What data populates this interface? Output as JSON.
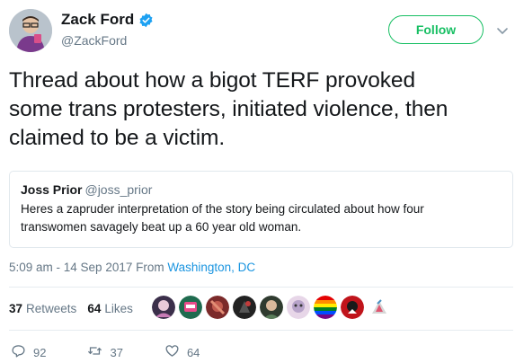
{
  "author": {
    "display_name": "Zack Ford",
    "handle": "@ZackFord",
    "verified_icon": "verified-badge-icon"
  },
  "follow_label": "Follow",
  "tweet": {
    "text_line1": "Thread about how a bigot TERF provoked",
    "text_line2": "some trans protesters, initiated violence, then",
    "text_line3": "claimed to be a victim."
  },
  "quoted_tweet": {
    "display_name": "Joss Prior",
    "handle": "@joss_prior",
    "text_line1": "Heres a zapruder interpretation of the story being circulated about how four",
    "text_line2": "transwomen savagely beat up a 60 year old woman."
  },
  "meta": {
    "timestamp": "5:09 am - 14 Sep 2017 From ",
    "location": "Washington, DC"
  },
  "stats": {
    "retweets_count": "37",
    "retweets_label": "Retweets",
    "likes_count": "64",
    "likes_label": "Likes"
  },
  "actions": {
    "reply_count": "92",
    "retweet_count": "37",
    "like_count": "64"
  },
  "colors": {
    "follow_green": "#17bf63",
    "link_blue": "#1b95e0",
    "muted": "#657786"
  }
}
